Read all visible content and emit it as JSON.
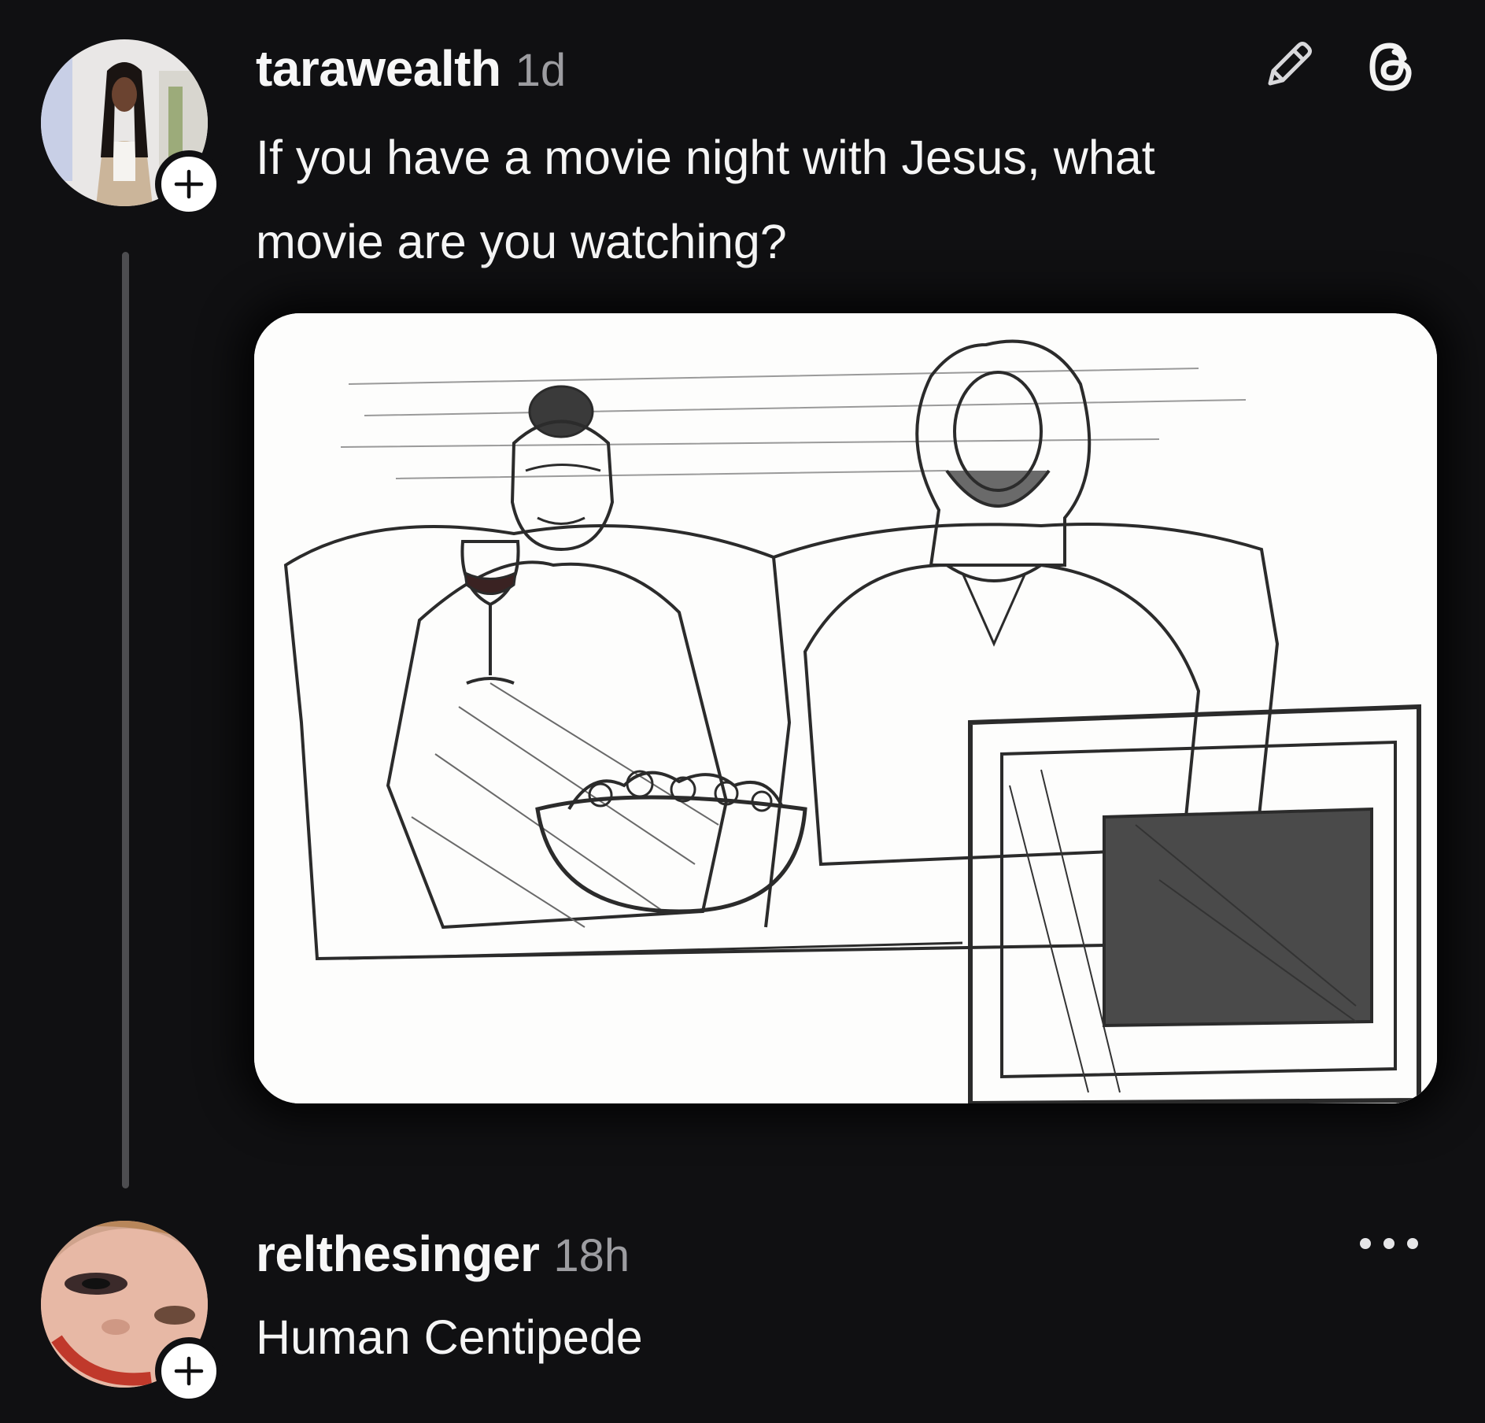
{
  "posts": [
    {
      "username": "tarawealth",
      "time": "1d",
      "text": "If you have a movie night with Jesus, what\nmovie are you watching?",
      "actions": [
        "edit-icon",
        "threads-logo-icon"
      ],
      "image": {
        "description_icon": "sketch-illustration"
      }
    },
    {
      "username": "relthesinger",
      "time": "18h",
      "text": "Human Centipede",
      "actions": [
        "more-options-icon"
      ]
    }
  ],
  "colors": {
    "background": "#101012",
    "text": "#f5f5f5",
    "muted": "#9d9da1",
    "thread_line": "#4d4d50",
    "badge": "#ffffff"
  }
}
